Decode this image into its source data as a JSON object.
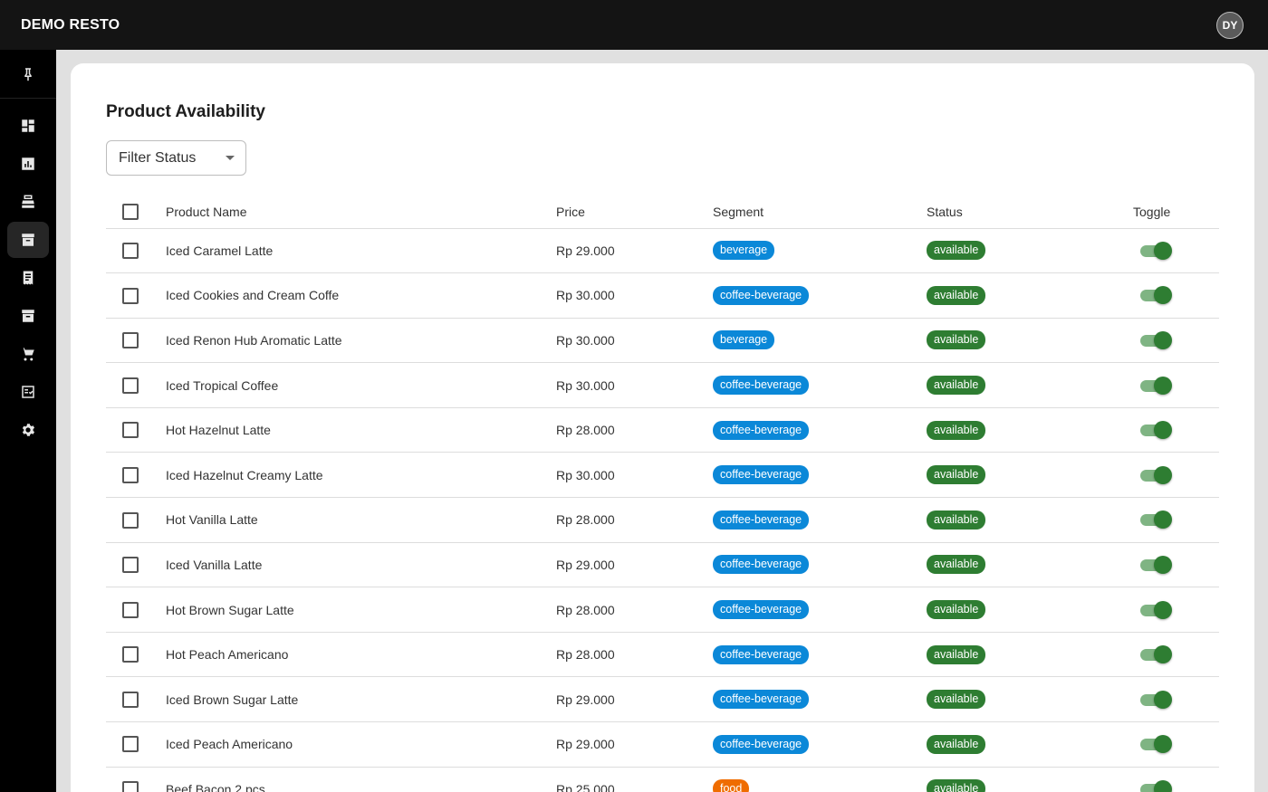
{
  "app": {
    "title": "DEMO RESTO",
    "avatar_initials": "DY"
  },
  "sidebar": {
    "pin_icon": "pin-icon",
    "items": [
      {
        "name": "dashboard",
        "icon": "dashboard-icon",
        "active": false
      },
      {
        "name": "reports",
        "icon": "bar-chart-icon",
        "active": false
      },
      {
        "name": "cashier",
        "icon": "cash-register-icon",
        "active": false
      },
      {
        "name": "product-availability",
        "icon": "archive-box-icon",
        "active": true
      },
      {
        "name": "receipts",
        "icon": "receipt-icon",
        "active": false
      },
      {
        "name": "inventory",
        "icon": "inventory-icon",
        "active": false
      },
      {
        "name": "orders",
        "icon": "cart-icon",
        "active": false
      },
      {
        "name": "checklist",
        "icon": "checklist-icon",
        "active": false
      },
      {
        "name": "settings",
        "icon": "gear-icon",
        "active": false
      }
    ]
  },
  "page": {
    "title": "Product Availability"
  },
  "filter": {
    "label": "Filter Status"
  },
  "table": {
    "headers": {
      "name": "Product Name",
      "price": "Price",
      "segment": "Segment",
      "status": "Status",
      "toggle": "Toggle"
    },
    "rows": [
      {
        "name": "Iced Caramel Latte",
        "price": "Rp 29.000",
        "segment": "beverage",
        "status": "available",
        "on": true
      },
      {
        "name": "Iced Cookies and Cream Coffe",
        "price": "Rp 30.000",
        "segment": "coffee-beverage",
        "status": "available",
        "on": true
      },
      {
        "name": "Iced Renon Hub Aromatic Latte",
        "price": "Rp 30.000",
        "segment": "beverage",
        "status": "available",
        "on": true
      },
      {
        "name": "Iced Tropical Coffee",
        "price": "Rp 30.000",
        "segment": "coffee-beverage",
        "status": "available",
        "on": true
      },
      {
        "name": "Hot Hazelnut Latte",
        "price": "Rp 28.000",
        "segment": "coffee-beverage",
        "status": "available",
        "on": true
      },
      {
        "name": "Iced Hazelnut Creamy Latte",
        "price": "Rp 30.000",
        "segment": "coffee-beverage",
        "status": "available",
        "on": true
      },
      {
        "name": "Hot Vanilla Latte",
        "price": "Rp 28.000",
        "segment": "coffee-beverage",
        "status": "available",
        "on": true
      },
      {
        "name": "Iced Vanilla Latte",
        "price": "Rp 29.000",
        "segment": "coffee-beverage",
        "status": "available",
        "on": true
      },
      {
        "name": "Hot Brown Sugar Latte",
        "price": "Rp 28.000",
        "segment": "coffee-beverage",
        "status": "available",
        "on": true
      },
      {
        "name": "Hot Peach Americano",
        "price": "Rp 28.000",
        "segment": "coffee-beverage",
        "status": "available",
        "on": true
      },
      {
        "name": "Iced Brown Sugar Latte",
        "price": "Rp 29.000",
        "segment": "coffee-beverage",
        "status": "available",
        "on": true
      },
      {
        "name": "Iced Peach Americano",
        "price": "Rp 29.000",
        "segment": "coffee-beverage",
        "status": "available",
        "on": true
      },
      {
        "name": "Beef Bacon 2 pcs",
        "price": "Rp 25.000",
        "segment": "food",
        "status": "available",
        "on": true
      }
    ]
  },
  "colors": {
    "segment_beverage": "#0b88d8",
    "segment_food": "#ef6c00",
    "status_available": "#2e7d32"
  }
}
